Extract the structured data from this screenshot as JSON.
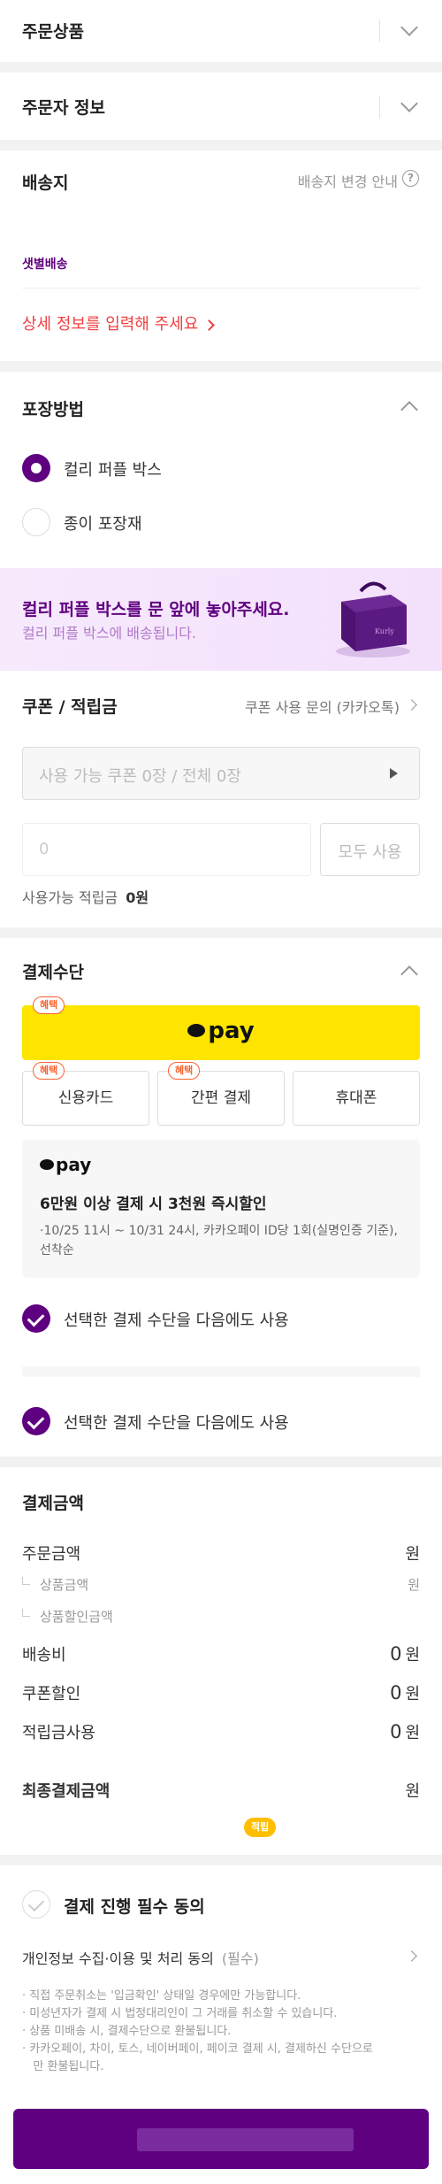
{
  "sections": {
    "order_items": "주문상품",
    "orderer_info": "주문자 정보",
    "shipping": {
      "title": "배송지",
      "change_guide": "배송지 변경 안내",
      "delivery_type": "샛별배송",
      "detail_prompt": "상세 정보를 입력해 주세요"
    },
    "packaging": {
      "title": "포장방법",
      "options": [
        "컬리 퍼플 박스",
        "종이 포장재"
      ],
      "banner_title": "컬리 퍼플 박스를 문 앞에 놓아주세요.",
      "banner_sub": "컬리 퍼플 박스에 배송됩니다."
    },
    "coupon": {
      "title": "쿠폰 / 적립금",
      "inquiry": "쿠폰 사용 문의 (카카오톡)",
      "coupon_select": "사용 가능 쿠폰 0장 / 전체 0장",
      "points_placeholder": "0",
      "use_all": "모두 사용",
      "available_points_label": "사용가능 적립금",
      "available_points_value": "0원"
    },
    "payment": {
      "title": "결제수단",
      "benefit_badge": "혜택",
      "kakaopay_logo": "pay",
      "methods": [
        "신용카드",
        "간편 결제",
        "휴대폰"
      ],
      "promo_logo": "pay",
      "promo_title": "6만원 이상 결제 시 3천원 즉시할인",
      "promo_desc": "·10/25 11시 ~ 10/31 24시, 카카오페이 ID당 1회(실명인증 기준), 선착순",
      "reuse_label": "선택한 결제 수단을 다음에도 사용",
      "reuse_label_2": "선택한 결제 수단을 다음에도 사용"
    },
    "summary": {
      "title": "결제금액",
      "order_amount": "주문금액",
      "order_amount_value": "원",
      "product_amount": "상품금액",
      "product_amount_value": "원",
      "product_discount": "상품할인금액",
      "shipping_fee": "배송비",
      "shipping_fee_num": "0",
      "coupon_discount": "쿠폰할인",
      "coupon_discount_num": "0",
      "points_used": "적립금사용",
      "points_used_num": "0",
      "won": "원",
      "final_amount": "최종결제금액",
      "final_amount_value": "원",
      "earn_badge": "적립"
    },
    "agreement": {
      "title": "결제 진행 필수 동의",
      "privacy": "개인정보 수집·이용 및 처리 동의",
      "required": "(필수)",
      "notes": [
        "· 직접 주문취소는 '입금확인' 상태일 경우에만 가능합니다.",
        "· 미성년자가 결제 시 법정대리인이 그 거래를 취소할 수 있습니다.",
        "· 상품 미배송 시, 결제수단으로 환불됩니다.",
        "· 카카오페이, 차이, 토스, 네이버페이, 페이코 결제 시, 결제하신 수단으로",
        "   만 환불됩니다."
      ]
    }
  },
  "colors": {
    "brand_purple": "#5f0080",
    "kakao_yellow": "#fee500",
    "alert_red": "#f03f40",
    "banner_bg": "#f5e6fb"
  },
  "icons": [
    "chevron-down-icon",
    "chevron-up-icon",
    "chevron-right-icon",
    "question-circle-icon",
    "play-triangle-icon",
    "check-icon",
    "purple-box-image"
  ]
}
